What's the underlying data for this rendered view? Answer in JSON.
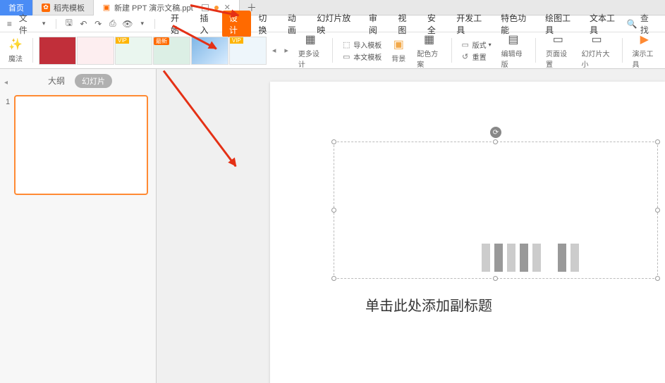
{
  "tabs": {
    "home": "首页",
    "templates": "稻壳模板",
    "new_doc": "新建 PPT 演示文稿.ppt"
  },
  "file_menu": "文件",
  "menu": {
    "start": "开始",
    "insert": "插入",
    "design": "设计",
    "transition": "切换",
    "animation": "动画",
    "slideshow": "幻灯片放映",
    "review": "审阅",
    "view": "视图",
    "security": "安全",
    "devtools": "开发工具",
    "special": "特色功能",
    "drawtools": "绘图工具",
    "texttools": "文本工具"
  },
  "find": "查找",
  "ribbon": {
    "magic": "魔法",
    "more_design": "更多设计",
    "import_tpl": "导入模板",
    "this_tpl": "本文模板",
    "background": "背景",
    "color_scheme": "配色方案",
    "layout": "版式",
    "reset": "重置",
    "edit_master": "编辑母版",
    "page_setup": "页面设置",
    "slide_size": "幻灯片大小",
    "present_tools": "演示工具",
    "vip": "VIP",
    "new_tag": "最新"
  },
  "sidebar": {
    "outline": "大纲",
    "slides": "幻灯片",
    "thumb_num": "1"
  },
  "slide": {
    "subtitle": "单击此处添加副标题"
  }
}
